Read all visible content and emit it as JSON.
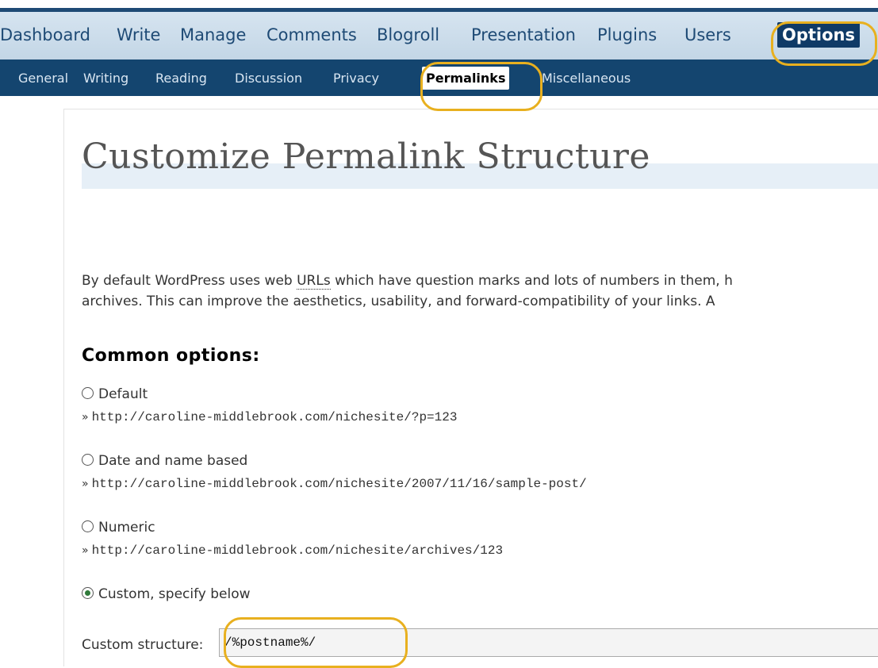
{
  "menu": {
    "items": [
      "Dashboard",
      "Write",
      "Manage",
      "Comments",
      "Blogroll",
      "Presentation",
      "Plugins",
      "Users",
      "Options"
    ],
    "active": "Options"
  },
  "submenu": {
    "items": [
      "General",
      "Writing",
      "Reading",
      "Discussion",
      "Privacy",
      "Permalinks",
      "Miscellaneous"
    ],
    "active": "Permalinks"
  },
  "page": {
    "title": "Customize Permalink Structure",
    "intro_line1_before": "By default WordPress uses web ",
    "intro_abbr": "URLs",
    "intro_line1_after": " which have question marks and lots of numbers in them, h",
    "intro_line2": "archives. This can improve the aesthetics, usability, and forward-compatibility of your links. A",
    "common_heading": "Common options:"
  },
  "options": [
    {
      "label": "Default",
      "url": "http://caroline-middlebrook.com/nichesite/?p=123",
      "checked": false
    },
    {
      "label": "Date and name based",
      "url": "http://caroline-middlebrook.com/nichesite/2007/11/16/sample-post/",
      "checked": false
    },
    {
      "label": "Numeric",
      "url": "http://caroline-middlebrook.com/nichesite/archives/123",
      "checked": false
    },
    {
      "label": "Custom, specify below",
      "url": "",
      "checked": true
    }
  ],
  "custom": {
    "label": "Custom structure:",
    "value": "/%postname%/"
  },
  "colors": {
    "menu_bg": "#cfe0ee",
    "submenu_bg": "#14456f",
    "active_tab": "#0f3a66",
    "highlight": "#e8b01f"
  }
}
